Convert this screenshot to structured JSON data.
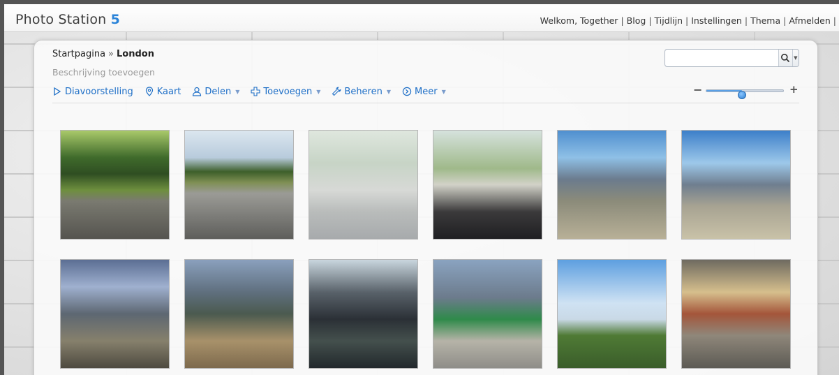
{
  "app": {
    "logo_text": "Photo Station",
    "logo_version": "5"
  },
  "toplinks": [
    "Welkom, Together",
    "Blog",
    "Tijdlijn",
    "Instellingen",
    "Thema",
    "Afmelden"
  ],
  "breadcrumb": {
    "root": "Startpagina",
    "separator": "»",
    "current": "London"
  },
  "description_placeholder": "Beschrijving toevoegen",
  "toolbar": {
    "slideshow": "Diavoorstelling",
    "map": "Kaart",
    "share": "Delen",
    "add": "Toevoegen",
    "manage": "Beheren",
    "more": "Meer"
  },
  "search": {
    "value": "",
    "placeholder": ""
  },
  "zoom": {
    "level": 0.46
  },
  "colors": {
    "accent": "#2a83d8",
    "link": "#1e6fc7"
  },
  "icons": {
    "slideshow": "play-icon",
    "map": "map-pin-icon",
    "share": "user-icon",
    "add": "plus-icon",
    "manage": "wrench-icon",
    "more": "circle-arrow-icon",
    "search": "search-icon"
  },
  "photos": [
    {
      "id": "park-path"
    },
    {
      "id": "park-crossing"
    },
    {
      "id": "train-woman-reading-1"
    },
    {
      "id": "train-woman-reading-2"
    },
    {
      "id": "station-roof-1"
    },
    {
      "id": "station-roof-2"
    },
    {
      "id": "station-platform-1"
    },
    {
      "id": "station-platform-2"
    },
    {
      "id": "station-platform-3"
    },
    {
      "id": "green-train"
    },
    {
      "id": "countryside-view"
    },
    {
      "id": "station-kiosk"
    }
  ]
}
